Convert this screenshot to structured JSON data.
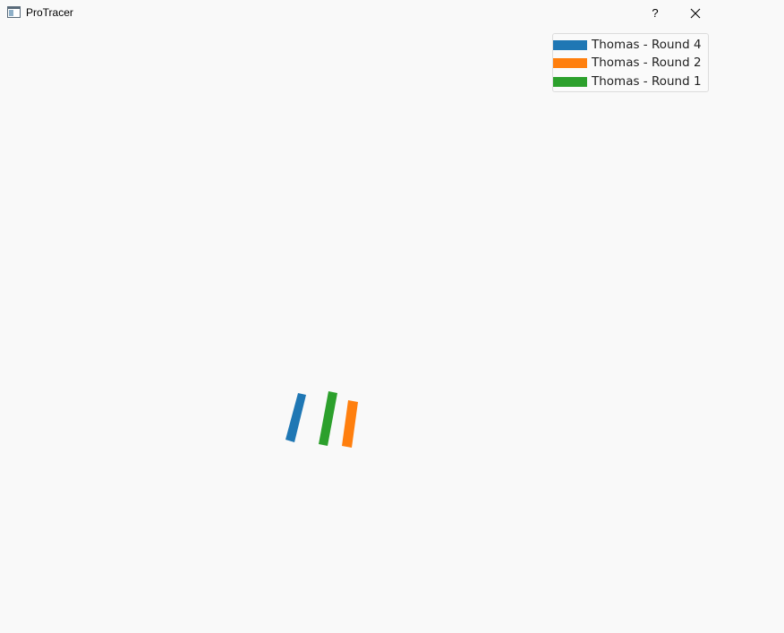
{
  "window": {
    "title": "ProTracer",
    "help_label": "?",
    "icons": {
      "app": "app-window-icon",
      "close": "close-icon"
    }
  },
  "legend": {
    "items": [
      {
        "label": "Thomas - Round 4",
        "color": "#1f77b4"
      },
      {
        "label": "Thomas - Round 2",
        "color": "#ff7f0e"
      },
      {
        "label": "Thomas - Round 1",
        "color": "#2ca02c"
      }
    ]
  },
  "colors": {
    "background": "#f9f9f9",
    "round4": "#1f77b4",
    "round2": "#ff7f0e",
    "round1": "#2ca02c"
  }
}
